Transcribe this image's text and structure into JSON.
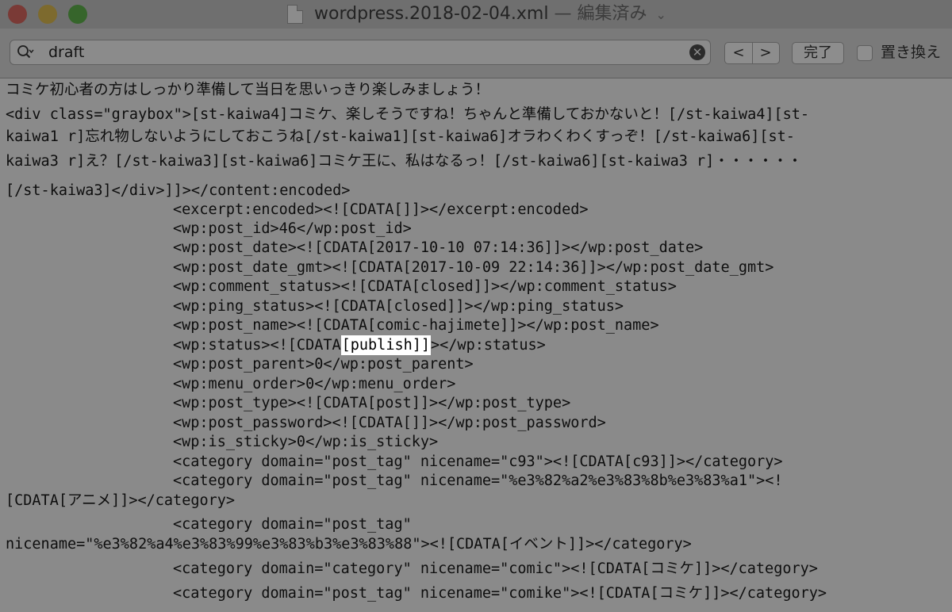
{
  "window": {
    "title": "wordpress.2018-02-04.xml",
    "status": "— 編集済み"
  },
  "find": {
    "value": "draft",
    "done_label": "完了",
    "replace_label": "置き換え",
    "prev_label": "<",
    "next_label": ">"
  },
  "editor": {
    "lines": [
      "コミケ初心者の方はしっかり準備して当日を思いっきり楽しみましょう！",
      "<div class=\"graybox\">[st-kaiwa4]コミケ、楽しそうですね！ちゃんと準備しておかないと！[/st-kaiwa4][st-",
      "kaiwa1 r]忘れ物しないようにしておこうね[/st-kaiwa1][st-kaiwa6]オラわくわくすっぞ！[/st-kaiwa6][st-",
      "kaiwa3 r]え？[/st-kaiwa3][st-kaiwa6]コミケ王に、私はなるっ！[/st-kaiwa6][st-kaiwa3 r]・・・・・・",
      "[/st-kaiwa3]</div>]]></content:encoded>",
      "<excerpt:encoded><![CDATA[]]></excerpt:encoded>",
      "<wp:post_id>46</wp:post_id>",
      "<wp:post_date><![CDATA[2017-10-10 07:14:36]]></wp:post_date>",
      "<wp:post_date_gmt><![CDATA[2017-10-09 22:14:36]]></wp:post_date_gmt>",
      "<wp:comment_status><![CDATA[closed]]></wp:comment_status>",
      "<wp:ping_status><![CDATA[closed]]></wp:ping_status>",
      "<wp:post_name><![CDATA[comic-hajimete]]></wp:post_name>",
      "<wp:status><![CDATA",
      "[publish]]",
      "></wp:status>",
      "<wp:post_parent>0</wp:post_parent>",
      "<wp:menu_order>0</wp:menu_order>",
      "<wp:post_type><![CDATA[post]]></wp:post_type>",
      "<wp:post_password><![CDATA[]]></wp:post_password>",
      "<wp:is_sticky>0</wp:is_sticky>",
      "<category domain=\"post_tag\" nicename=\"c93\"><![CDATA[c93]]></category>",
      "<category domain=\"post_tag\" nicename=\"%e3%82%a2%e3%83%8b%e3%83%a1\"><!",
      "[CDATA[アニメ]]></category>",
      "<category domain=\"post_tag\"",
      "nicename=\"%e3%82%a4%e3%83%99%e3%83%b3%e3%83%88\"><![CDATA[イベント]]></category>",
      "<category domain=\"category\" nicename=\"comic\"><![CDATA[コミケ]]></category>",
      "<category domain=\"post_tag\" nicename=\"comike\"><![CDATA[コミケ]]></category>"
    ]
  }
}
